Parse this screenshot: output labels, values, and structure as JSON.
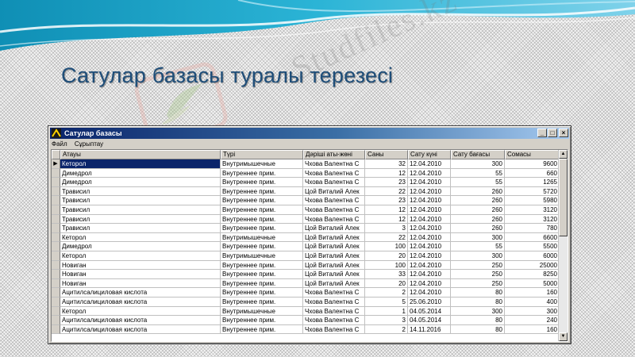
{
  "slide": {
    "title": "Сатулар базасы туралы терезесі",
    "watermark": "Studfiles.kz"
  },
  "window": {
    "title": "Сатулар базасы",
    "controls": {
      "minimize": "_",
      "maximize": "□",
      "close": "×"
    },
    "menu": [
      "Файл",
      "Сұрыптау"
    ]
  },
  "grid": {
    "columns": [
      "Атауы",
      "Түрі",
      "Дәріші аты-жөні",
      "Саны",
      "Сату күні",
      "Сату бағасы",
      "Сомасы"
    ],
    "selected_row": 0,
    "rows": [
      [
        "Кеторол",
        "Внутримышечные",
        "Чхова Валентна С",
        "32",
        "12.04.2010",
        "300",
        "9600"
      ],
      [
        "Димедрол",
        "Внутреннее прим.",
        "Чхова Валентна С",
        "12",
        "12.04.2010",
        "55",
        "660"
      ],
      [
        "Димедрол",
        "Внутреннее прим.",
        "Чхова Валентна С",
        "23",
        "12.04.2010",
        "55",
        "1265"
      ],
      [
        "Трависил",
        "Внутреннее прим.",
        "Цой Виталий Алек",
        "22",
        "12.04.2010",
        "260",
        "5720"
      ],
      [
        "Трависил",
        "Внутреннее прим.",
        "Чхова Валентна С",
        "23",
        "12.04.2010",
        "260",
        "5980"
      ],
      [
        "Трависил",
        "Внутреннее прим.",
        "Чхова Валентна С",
        "12",
        "12.04.2010",
        "260",
        "3120"
      ],
      [
        "Трависил",
        "Внутреннее прим.",
        "Чхова Валентна С",
        "12",
        "12.04.2010",
        "260",
        "3120"
      ],
      [
        "Трависил",
        "Внутреннее прим.",
        "Цой Виталий Алек",
        "3",
        "12.04.2010",
        "260",
        "780"
      ],
      [
        "Кеторол",
        "Внутримышечные",
        "Цой Виталий Алек",
        "22",
        "12.04.2010",
        "300",
        "6600"
      ],
      [
        "Димедрол",
        "Внутреннее прим.",
        "Цой Виталий Алек",
        "100",
        "12.04.2010",
        "55",
        "5500"
      ],
      [
        "Кеторол",
        "Внутримышечные",
        "Цой Виталий Алек",
        "20",
        "12.04.2010",
        "300",
        "6000"
      ],
      [
        "Новиган",
        "Внутреннее прим.",
        "Цой Виталий Алек",
        "100",
        "12.04.2010",
        "250",
        "25000"
      ],
      [
        "Новиган",
        "Внутреннее прим.",
        "Цой Виталий Алек",
        "33",
        "12.04.2010",
        "250",
        "8250"
      ],
      [
        "Новиган",
        "Внутреннее прим.",
        "Цой Виталий Алек",
        "20",
        "12.04.2010",
        "250",
        "5000"
      ],
      [
        "Ацитилсалициловая кислота",
        "Внутреннее прим.",
        "Чхова Валентна С",
        "2",
        "12.04.2010",
        "80",
        "160"
      ],
      [
        "Ацитилсалициловая кислота",
        "Внутреннее прим.",
        "Чхова Валентна С",
        "5",
        "25.06.2010",
        "80",
        "400"
      ],
      [
        "Кеторол",
        "Внутримышечные",
        "Чхова Валентна С",
        "1",
        "04.05.2014",
        "300",
        "300"
      ],
      [
        "Ацитилсалициловая кислота",
        "Внутреннее прим.",
        "Чхова Валентна С",
        "3",
        "04.05.2014",
        "80",
        "240"
      ],
      [
        "Ацитилсалициловая кислота",
        "Внутреннее прим.",
        "Чхова Валентна С",
        "2",
        "14.11.2016",
        "80",
        "160"
      ]
    ]
  },
  "scrollbar": {
    "up": "▲",
    "down": "▼"
  },
  "icons": {
    "row_indicator": "triangle-right-icon",
    "window": "app-icon"
  },
  "colors": {
    "title_text": "#1f4e79",
    "selection": "#0a246a",
    "titlebar": "#0a246a",
    "banner": "#1aa8c8"
  }
}
